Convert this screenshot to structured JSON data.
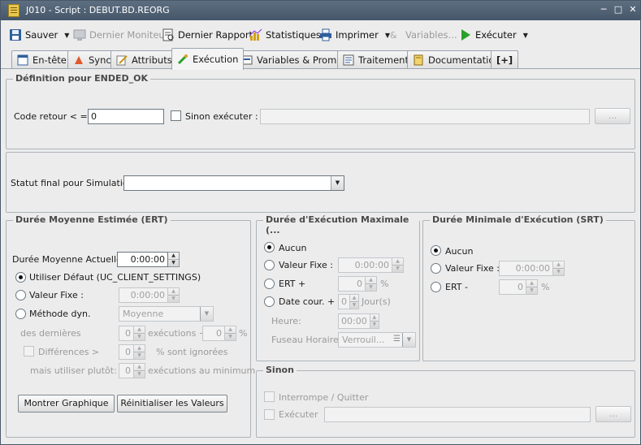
{
  "window": {
    "title": "J010 - Script : DEBUT.BD.REORG",
    "controls": [
      "minimize-icon",
      "maximize-icon",
      "close-icon"
    ]
  },
  "toolbar": {
    "save": "Sauver",
    "last_monitor": "Dernier Moniteur",
    "last_report": "Dernier Rapport",
    "statistics": "Statistiques",
    "print": "Imprimer",
    "variables": "Variables...",
    "execute": "Exécuter"
  },
  "tabs": [
    {
      "label": "En-tête"
    },
    {
      "label": "Sync"
    },
    {
      "label": "Attributs"
    },
    {
      "label": "Exécution"
    },
    {
      "label": "Variables & Prompts"
    },
    {
      "label": "Traitement"
    },
    {
      "label": "Documentation"
    },
    {
      "label": "[+]"
    }
  ],
  "active_tab": "Exécution",
  "ended_ok": {
    "legend": "Définition pour ENDED_OK",
    "return_code_label": "Code retour < =:",
    "return_code_value": "0",
    "else_execute_label": "Sinon exécuter :",
    "else_execute_value": "",
    "browse_label": "..."
  },
  "simulation": {
    "label": "Statut final pour Simulation:",
    "value": ""
  },
  "ert": {
    "legend": "Durée Moyenne Estimée (ERT)",
    "current_label": "Durée Moyenne Actuelle:",
    "current_value": "0:00:00",
    "default_label": "Utiliser Défaut (UC_CLIENT_SETTINGS)",
    "fixed_label": "Valeur Fixe :",
    "fixed_value": "0:00:00",
    "dynamic_label": "Méthode dyn.",
    "dynamic_value": "Moyenne",
    "last_label": "des dernières",
    "last_value": "0",
    "executions_plus_label": "exécutions +",
    "plus_value": "0",
    "percent_label": "%",
    "differences_label": "Différences >",
    "differences_value": "0",
    "ignored_label": "% sont ignorées",
    "but_use_label": "mais utiliser plutôt:",
    "but_use_value": "0",
    "min_executions_label": "exécutions au minimum",
    "show_graph": "Montrer Graphique",
    "reset_values": "Réinitialiser les Valeurs"
  },
  "max_runtime": {
    "legend": "Durée d'Exécution Maximale (...",
    "none_label": "Aucun",
    "fixed_label": "Valeur Fixe :",
    "fixed_value": "0:00:00",
    "ert_label": "ERT +",
    "ert_value": "0",
    "percent_label": "%",
    "date_label": "Date cour. +",
    "date_value": "0",
    "days_label": "Jour(s)",
    "time_label": "Heure:",
    "time_value": "00:00",
    "tz_label": "Fuseau Horaire:",
    "tz_value": "Verrouil..."
  },
  "min_runtime": {
    "legend": "Durée Minimale d'Exécution (SRT)",
    "none_label": "Aucun",
    "fixed_label": "Valeur Fixe :",
    "fixed_value": "0:00:00",
    "ert_label": "ERT -",
    "ert_value": "0",
    "percent_label": "%"
  },
  "else": {
    "legend": "Sinon",
    "cancel_label": "Interrompe / Quitter",
    "execute_label": "Exécuter",
    "execute_value": "",
    "browse_label": "..."
  }
}
